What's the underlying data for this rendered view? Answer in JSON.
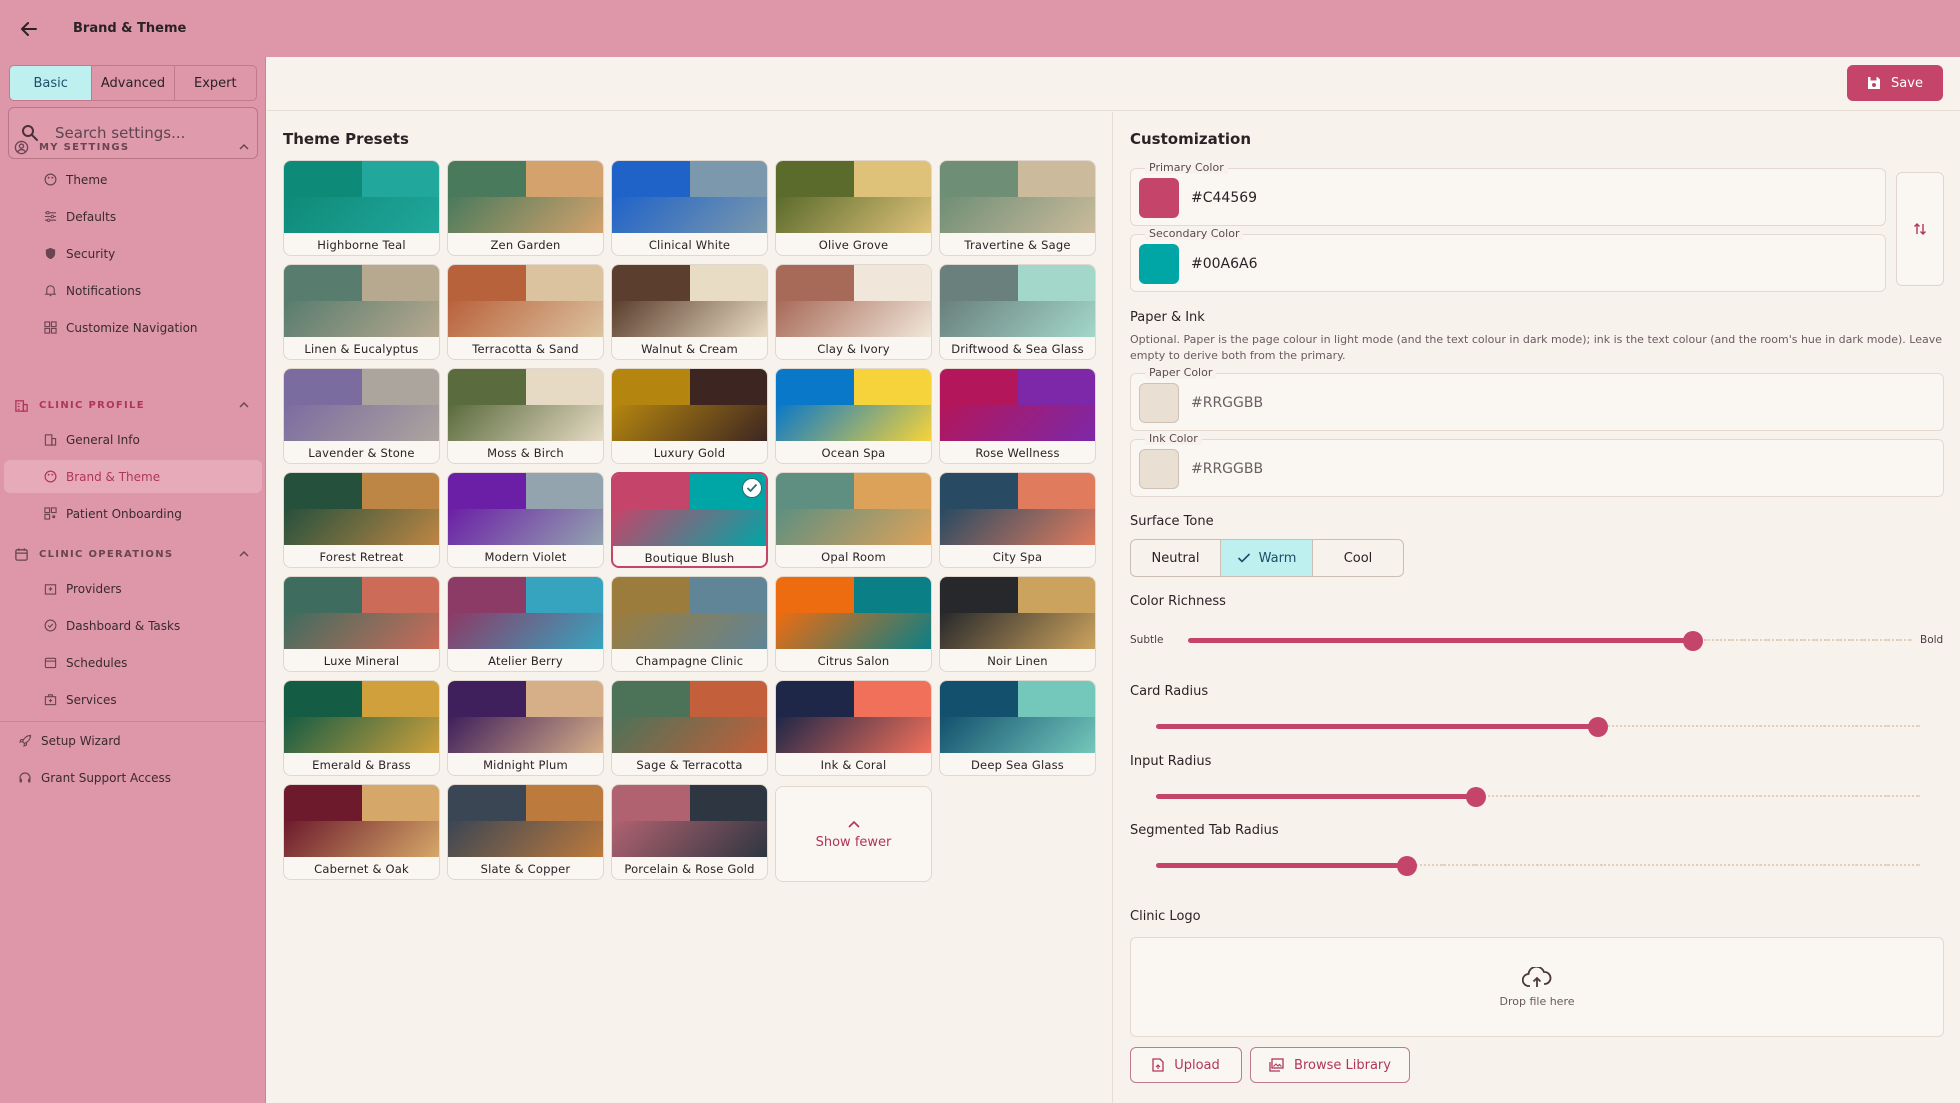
{
  "header": {
    "title": "Brand & Theme",
    "back_icon": "arrow-left-icon"
  },
  "sidebar": {
    "modes": [
      {
        "label": "Basic",
        "active": true
      },
      {
        "label": "Advanced",
        "active": false
      },
      {
        "label": "Expert",
        "active": false
      }
    ],
    "search_placeholder": "Search settings...",
    "sections": [
      {
        "label": "MY SETTINGS",
        "icon": "user-circle-icon",
        "items": [
          {
            "label": "Theme",
            "icon": "palette-icon"
          },
          {
            "label": "Defaults",
            "icon": "sliders-icon"
          },
          {
            "label": "Security",
            "icon": "shield-icon"
          },
          {
            "label": "Notifications",
            "icon": "bell-icon"
          },
          {
            "label": "Customize Navigation",
            "icon": "layout-icon"
          }
        ]
      },
      {
        "label": "CLINIC PROFILE",
        "icon": "building-icon",
        "items": [
          {
            "label": "General Info",
            "icon": "building-icon"
          },
          {
            "label": "Brand & Theme",
            "icon": "palette-icon",
            "active": true
          },
          {
            "label": "Patient Onboarding",
            "icon": "qr-icon"
          }
        ]
      },
      {
        "label": "CLINIC OPERATIONS",
        "icon": "calendar-icon",
        "items": [
          {
            "label": "Providers",
            "icon": "hospital-icon"
          },
          {
            "label": "Dashboard & Tasks",
            "icon": "check-circle-icon"
          },
          {
            "label": "Schedules",
            "icon": "calendar-icon"
          },
          {
            "label": "Services",
            "icon": "medical-bag-icon"
          }
        ]
      }
    ],
    "bottom_items": [
      {
        "label": "Setup Wizard",
        "icon": "rocket-icon"
      },
      {
        "label": "Grant Support Access",
        "icon": "headset-icon"
      }
    ]
  },
  "toolbar": {
    "save_label": "Save",
    "save_icon": "floppy-icon"
  },
  "presets": {
    "title": "Theme Presets",
    "show_fewer_label": "Show fewer",
    "items": [
      {
        "name": "Highborne Teal",
        "c1": "#0e8a78",
        "c2": "#21a79c"
      },
      {
        "name": "Zen Garden",
        "c1": "#4a7a5c",
        "c2": "#d4a26c"
      },
      {
        "name": "Clinical White",
        "c1": "#1f63c9",
        "c2": "#7b98ac"
      },
      {
        "name": "Olive Grove",
        "c1": "#5b6b2c",
        "c2": "#dfc27a"
      },
      {
        "name": "Travertine & Sage",
        "c1": "#6f8e76",
        "c2": "#cbbb9c"
      },
      {
        "name": "Linen & Eucalyptus",
        "c1": "#587c6e",
        "c2": "#b7a990"
      },
      {
        "name": "Terracotta & Sand",
        "c1": "#b8623c",
        "c2": "#dcc3a0"
      },
      {
        "name": "Walnut & Cream",
        "c1": "#5b3e2d",
        "c2": "#e9dcc5"
      },
      {
        "name": "Clay & Ivory",
        "c1": "#a86a58",
        "c2": "#f0e7da"
      },
      {
        "name": "Driftwood & Sea Glass",
        "c1": "#6a807d",
        "c2": "#a3d7ca"
      },
      {
        "name": "Lavender & Stone",
        "c1": "#7b6ca0",
        "c2": "#aca59e"
      },
      {
        "name": "Moss & Birch",
        "c1": "#5a6b3d",
        "c2": "#e6dac4"
      },
      {
        "name": "Luxury Gold",
        "c1": "#b5860f",
        "c2": "#3d2622"
      },
      {
        "name": "Ocean Spa",
        "c1": "#0a78c8",
        "c2": "#f6d33a"
      },
      {
        "name": "Rose Wellness",
        "c1": "#b3165a",
        "c2": "#7d28a8"
      },
      {
        "name": "Forest Retreat",
        "c1": "#25503c",
        "c2": "#bd8644"
      },
      {
        "name": "Modern Violet",
        "c1": "#6b1fa6",
        "c2": "#93a4af"
      },
      {
        "name": "Boutique Blush",
        "c1": "#c44569",
        "c2": "#00a6a6",
        "selected": true
      },
      {
        "name": "Opal Room",
        "c1": "#5e8f80",
        "c2": "#dda25a"
      },
      {
        "name": "City Spa",
        "c1": "#284a62",
        "c2": "#e17b5e"
      },
      {
        "name": "Luxe Mineral",
        "c1": "#3e6c5f",
        "c2": "#cc6b58"
      },
      {
        "name": "Atelier Berry",
        "c1": "#8c3a66",
        "c2": "#37a4bf"
      },
      {
        "name": "Champagne Clinic",
        "c1": "#9c7c3c",
        "c2": "#5f8597"
      },
      {
        "name": "Citrus Salon",
        "c1": "#ee6c10",
        "c2": "#0a7f86"
      },
      {
        "name": "Noir Linen",
        "c1": "#27282c",
        "c2": "#cca35e"
      },
      {
        "name": "Emerald & Brass",
        "c1": "#155c44",
        "c2": "#cfa03c"
      },
      {
        "name": "Midnight Plum",
        "c1": "#3f1f5c",
        "c2": "#d6ae88"
      },
      {
        "name": "Sage & Terracotta",
        "c1": "#4c7258",
        "c2": "#c35f3a"
      },
      {
        "name": "Ink & Coral",
        "c1": "#1f2748",
        "c2": "#f1705a"
      },
      {
        "name": "Deep Sea Glass",
        "c1": "#13506e",
        "c2": "#74c8bb"
      },
      {
        "name": "Cabernet & Oak",
        "c1": "#6d1b2c",
        "c2": "#d5a869"
      },
      {
        "name": "Slate & Copper",
        "c1": "#3b4654",
        "c2": "#bd7a3d"
      },
      {
        "name": "Porcelain & Rose Gold",
        "c1": "#b16270",
        "c2": "#2e3641"
      }
    ]
  },
  "customization": {
    "title": "Customization",
    "primary": {
      "label": "Primary Color",
      "value": "#C44569",
      "color": "#C44569"
    },
    "secondary": {
      "label": "Secondary Color",
      "value": "#00A6A6",
      "color": "#00A6A6"
    },
    "swap_icon": "swap-vertical-icon",
    "paper_ink": {
      "title": "Paper & Ink",
      "description": "Optional. Paper is the page colour in light mode (and the text colour in dark mode); ink is the text colour (and the room's hue in dark mode). Leave empty to derive both from the primary.",
      "paper": {
        "label": "Paper Color",
        "placeholder": "#RRGGBB"
      },
      "ink": {
        "label": "Ink Color",
        "placeholder": "#RRGGBB"
      }
    },
    "surface_tone": {
      "title": "Surface Tone",
      "options": [
        {
          "label": "Neutral",
          "active": false
        },
        {
          "label": "Warm",
          "active": true
        },
        {
          "label": "Cool",
          "active": false
        }
      ]
    },
    "richness": {
      "title": "Color Richness",
      "min_label": "Subtle",
      "max_label": "Bold",
      "value": 0.7
    },
    "card_radius": {
      "title": "Card Radius",
      "value": 0.58
    },
    "input_radius": {
      "title": "Input Radius",
      "value": 0.42
    },
    "tab_radius": {
      "title": "Segmented Tab Radius",
      "value": 0.33
    },
    "logo": {
      "title": "Clinic Logo",
      "drop_text": "Drop file here",
      "upload_label": "Upload",
      "browse_label": "Browse Library"
    }
  }
}
